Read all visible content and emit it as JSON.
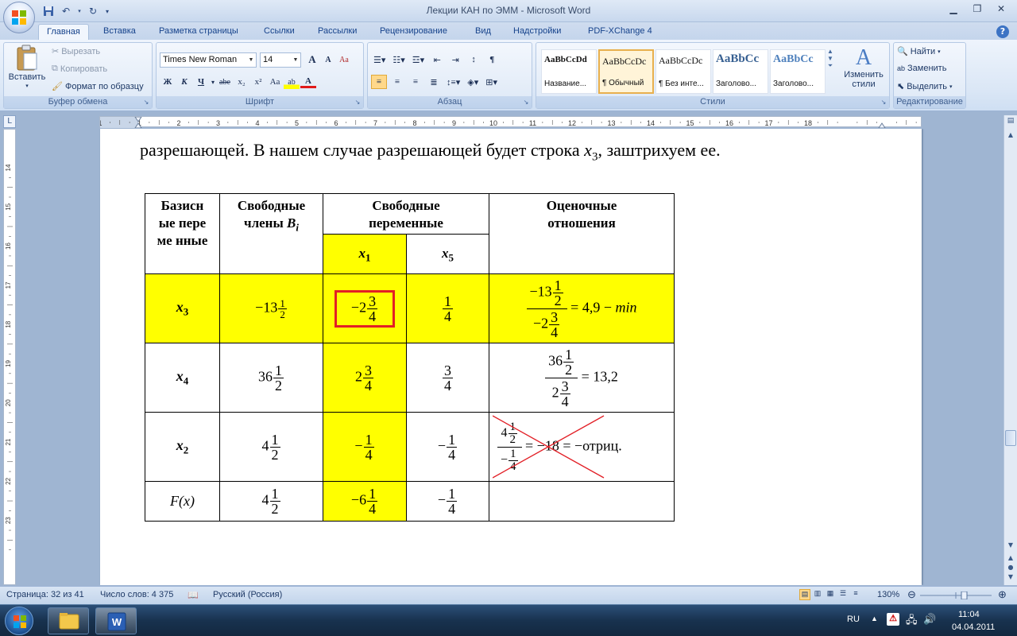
{
  "window": {
    "title": "Лекции КАН по ЭММ - Microsoft Word"
  },
  "qat": {
    "save_icon": "save-icon",
    "undo_icon": "undo-icon",
    "redo_icon": "redo-icon",
    "customize_icon": "chevron-down-icon"
  },
  "tabs": [
    {
      "label": "Главная",
      "active": true
    },
    {
      "label": "Вставка"
    },
    {
      "label": "Разметка страницы"
    },
    {
      "label": "Ссылки"
    },
    {
      "label": "Рассылки"
    },
    {
      "label": "Рецензирование"
    },
    {
      "label": "Вид"
    },
    {
      "label": "Надстройки"
    },
    {
      "label": "PDF-XChange 4"
    }
  ],
  "ribbon": {
    "clipboard": {
      "label": "Буфер обмена",
      "paste": "Вставить",
      "cut": "Вырезать",
      "copy": "Копировать",
      "format_painter": "Формат по образцу"
    },
    "font": {
      "label": "Шрифт",
      "font_name": "Times New Roman",
      "font_size": "14",
      "grow": "A",
      "shrink": "A",
      "clear": "Aa",
      "bold": "Ж",
      "italic": "К",
      "underline": "Ч",
      "strike": "abe",
      "sub": "x₂",
      "sup": "x²",
      "case": "Aa",
      "highlight": "ab",
      "color": "A"
    },
    "paragraph": {
      "label": "Абзац"
    },
    "styles": {
      "label": "Стили",
      "items": [
        {
          "preview": "AaBbCcDd",
          "name": "Название..."
        },
        {
          "preview": "AaBbCcDc",
          "name": "¶ Обычный",
          "selected": true
        },
        {
          "preview": "AaBbCcDc",
          "name": "¶ Без инте..."
        },
        {
          "preview": "AaBbCc",
          "name": "Заголово..."
        },
        {
          "preview": "AaBbCc",
          "name": "Заголово..."
        }
      ],
      "change": "Изменить",
      "change2": "стили"
    },
    "editing": {
      "label": "Редактирование",
      "find": "Найти",
      "replace": "Заменить",
      "select": "Выделить"
    }
  },
  "ruler": {
    "h_numbers": [
      "1",
      "1",
      "2",
      "3",
      "4",
      "5",
      "6",
      "7",
      "8",
      "9",
      "10",
      "11",
      "12",
      "13",
      "14",
      "15",
      "16",
      "17",
      "18"
    ],
    "v_numbers": [
      "14",
      "15",
      "16",
      "17",
      "18",
      "19",
      "20",
      "21",
      "22",
      "23"
    ]
  },
  "document": {
    "line_pre": "разрешающей. В нашем случае разрешающей будет строка ",
    "line_var": "x",
    "line_sub": "3",
    "line_post": ", заштрихуем ее.",
    "table": {
      "h_basic": "Базисн ые переме нные",
      "h_free_members": "Свободные члены ",
      "h_free_members_var": "B",
      "h_free_members_sub": "i",
      "h_free_vars": "Свободные переменные",
      "h_ratio": "Оценочные отношения",
      "h_x1": "x",
      "h_x1_sub": "1",
      "h_x5": "x",
      "h_x5_sub": "5",
      "rows": [
        {
          "basis": "x",
          "basis_sub": "3",
          "b_whole": "−13",
          "b_num": "1",
          "b_den": "2",
          "x1_whole": "−2",
          "x1_num": "3",
          "x1_den": "4",
          "x5_num": "1",
          "x5_den": "4",
          "ratio_num_whole": "−13",
          "ratio_num_num": "1",
          "ratio_num_den": "2",
          "ratio_den_whole": "−2",
          "ratio_den_num": "3",
          "ratio_den_den": "4",
          "ratio_result": "= 4,9 − ",
          "ratio_min": "min"
        },
        {
          "basis": "x",
          "basis_sub": "4",
          "b_whole": "36",
          "b_num": "1",
          "b_den": "2",
          "x1_whole": "2",
          "x1_num": "3",
          "x1_den": "4",
          "x5_num": "3",
          "x5_den": "4",
          "ratio_num_whole": "36",
          "ratio_num_num": "1",
          "ratio_num_den": "2",
          "ratio_den_whole": "2",
          "ratio_den_num": "3",
          "ratio_den_den": "4",
          "ratio_result": "= 13,2"
        },
        {
          "basis": "x",
          "basis_sub": "2",
          "b_whole": "4",
          "b_num": "1",
          "b_den": "2",
          "x1_whole": "−",
          "x1_num": "1",
          "x1_den": "4",
          "x5_whole": "−",
          "x5_num": "1",
          "x5_den": "4",
          "ratio_num_whole": "4",
          "ratio_num_num": "1",
          "ratio_num_den": "2",
          "ratio_den_whole": "−",
          "ratio_den_num": "1",
          "ratio_den_den": "4",
          "ratio_result": "= −18 = −отриц."
        },
        {
          "basis": "F(x)",
          "b_whole": "4",
          "b_num": "1",
          "b_den": "2",
          "x1_whole": "−6",
          "x1_num": "1",
          "x1_den": "4",
          "x5_whole": "−",
          "x5_num": "1",
          "x5_den": "4"
        }
      ]
    }
  },
  "statusbar": {
    "page": "Страница: 32 из 41",
    "words": "Число слов: 4 375",
    "language": "Русский (Россия)",
    "zoom": "130%",
    "zoom_fraction": 0.62
  },
  "taskbar": {
    "lang": "RU",
    "time": "11:04",
    "date": "04.04.2011"
  },
  "colors": {
    "highlight": "#ffff00",
    "pivot_border": "#e21f26",
    "cross": "#e21f26"
  }
}
